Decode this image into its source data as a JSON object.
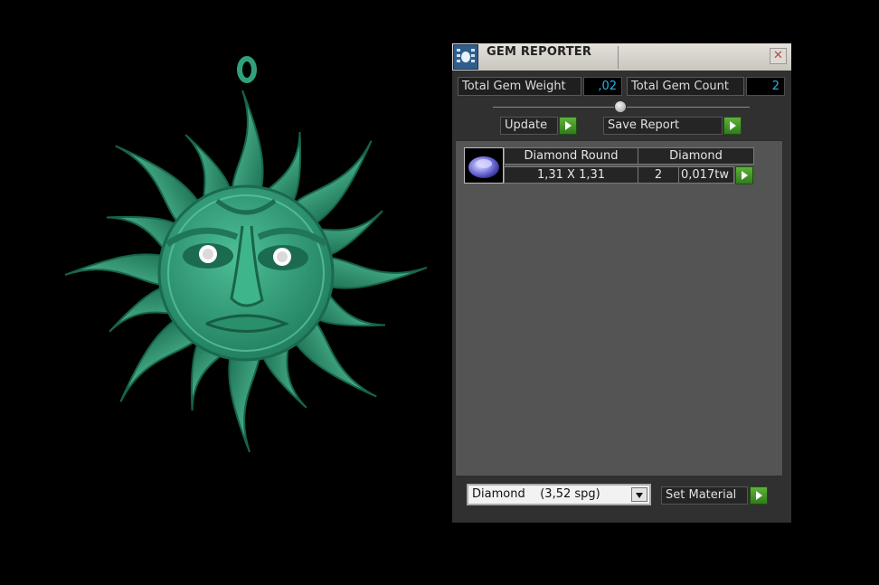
{
  "window": {
    "title": "GEM REPORTER",
    "close_glyph": "✕",
    "app_icon": "gem-reporter-icon"
  },
  "stats": {
    "weight_label": "Total Gem Weight",
    "weight_value": ",02",
    "count_label": "Total Gem Count",
    "count_value": "2"
  },
  "actions": {
    "update_label": "Update",
    "save_label": "Save Report",
    "set_material_label": "Set Material"
  },
  "gem_list": [
    {
      "thumbnail": "round-diamond-icon",
      "shape": "Diamond Round",
      "material": "Diamond",
      "size": "1,31 X 1,31",
      "count": "2",
      "weight": "0,017tw"
    }
  ],
  "material_select": {
    "selected": "Diamond    (3,52 spg)"
  },
  "colors": {
    "model": "#2fa27c",
    "panel_bg": "#303030",
    "value_text": "#28b4e6",
    "go_button": "#3f9a27"
  }
}
